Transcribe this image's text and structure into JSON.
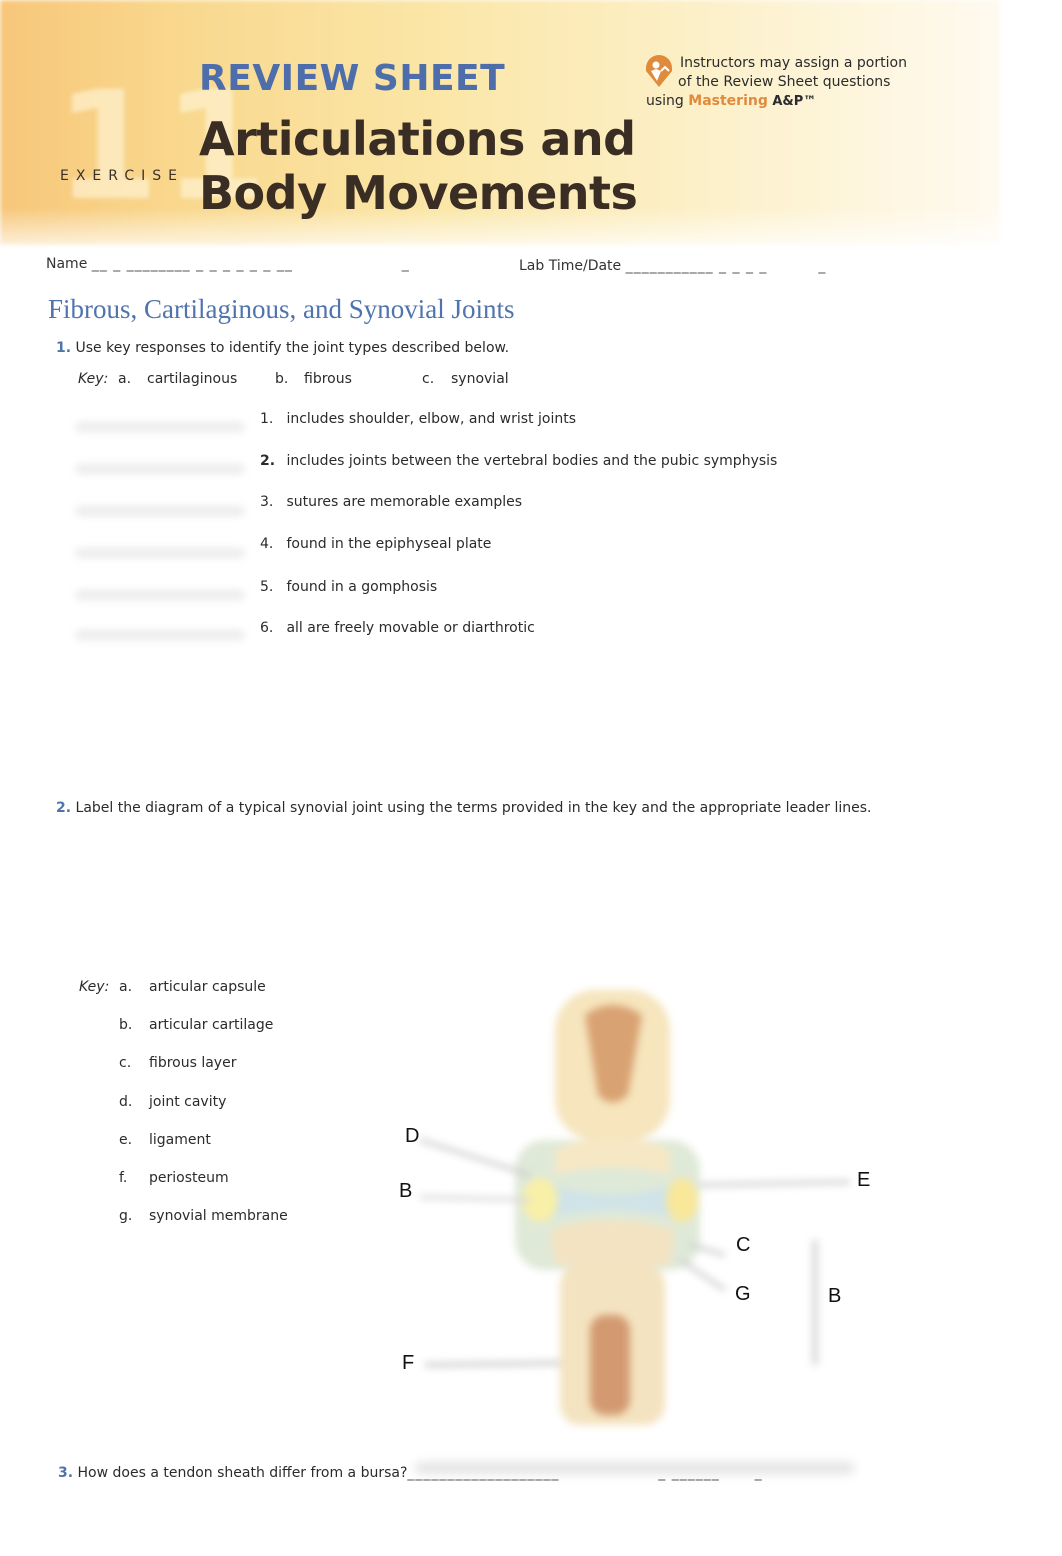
{
  "header": {
    "review_sheet": "REVIEW SHEET",
    "exercise_label": "EXERCISE",
    "exercise_number": "11",
    "title_line1": "Articulations and",
    "title_line2": "Body Movements",
    "mastering": {
      "line1": "Instructors may assign a portion",
      "line2": "of the Review Sheet questions",
      "line3_prefix": "using",
      "brand": "Mastering",
      "product": "A&P™",
      "icon": "mastering-logo-icon",
      "accent_color": "#e08a3c"
    }
  },
  "fields": {
    "name_label": "Name",
    "name_blank": "__  _ ________ _ _ _ _ _ _ __",
    "name_tail": "_",
    "lab_label": "Lab Time/Date",
    "lab_blank": "___________ _ _ _ _",
    "lab_tail": "_"
  },
  "section": {
    "heading": "Fibrous, Cartilaginous, and Synovial Joints",
    "color": "#4f74ad"
  },
  "question1": {
    "number": "1.",
    "prompt": "Use key responses to identify the joint types described below.",
    "key_label": "Key:",
    "key": [
      {
        "letter": "a.",
        "term": "cartilaginous"
      },
      {
        "letter": "b.",
        "term": "fibrous"
      },
      {
        "letter": "c.",
        "term": "synovial"
      }
    ],
    "items": [
      {
        "number": "1.",
        "text": "includes shoulder, elbow, and wrist joints",
        "answer": ""
      },
      {
        "number": "2.",
        "text": "includes joints between the vertebral bodies and the pubic symphysis",
        "answer": ""
      },
      {
        "number": "3.",
        "text": "sutures are memorable examples",
        "answer": ""
      },
      {
        "number": "4.",
        "text": "found in the epiphyseal plate",
        "answer": ""
      },
      {
        "number": "5.",
        "text": "found in a gomphosis",
        "answer": ""
      },
      {
        "number": "6.",
        "text": "all are freely movable or diarthrotic",
        "answer": ""
      }
    ]
  },
  "question2": {
    "number": "2.",
    "prompt": "Label the diagram of a typical synovial joint using the terms provided in the key and the appropriate leader lines.",
    "key_label": "Key:",
    "key": [
      {
        "letter": "a.",
        "term": "articular capsule"
      },
      {
        "letter": "b.",
        "term": "articular cartilage"
      },
      {
        "letter": "c.",
        "term": "fibrous layer"
      },
      {
        "letter": "d.",
        "term": "joint cavity"
      },
      {
        "letter": "e.",
        "term": "ligament"
      },
      {
        "letter": "f.",
        "term": "periosteum"
      },
      {
        "letter": "g.",
        "term": "synovial membrane"
      }
    ],
    "diagram_labels": [
      "D",
      "B",
      "E",
      "C",
      "G",
      "B",
      "F"
    ]
  },
  "question3": {
    "number": "3.",
    "prompt": "How does a tendon sheath differ from a bursa?",
    "blank": "___________________",
    "blank2": "_ ______",
    "blank_tail": "_"
  }
}
